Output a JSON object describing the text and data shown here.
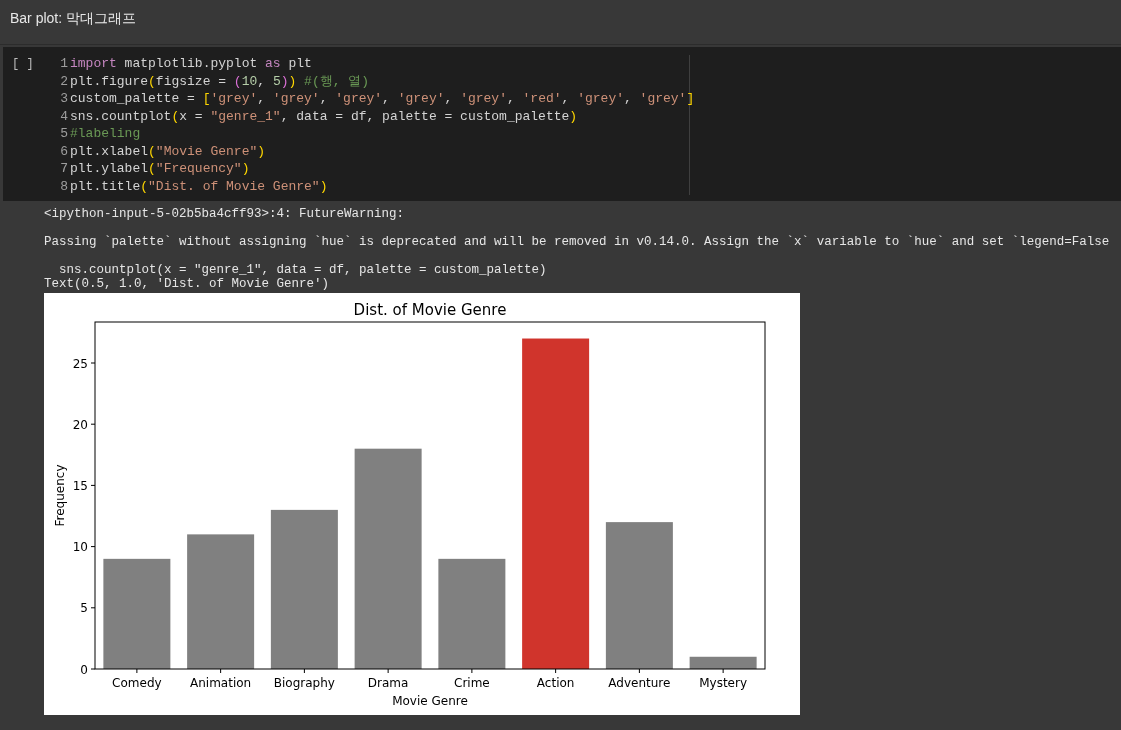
{
  "section_title": "Bar plot: 막대그래프",
  "code_cell": {
    "run_indicator": "[ ]",
    "lines": [
      {
        "n": "1",
        "tokens": [
          {
            "kind": "keyword",
            "text": "import"
          },
          {
            "kind": "plain",
            "text": " matplotlib.pyplot "
          },
          {
            "kind": "keyword",
            "text": "as"
          },
          {
            "kind": "plain",
            "text": " plt"
          }
        ]
      },
      {
        "n": "2",
        "tokens": [
          {
            "kind": "plain",
            "text": "plt.figure"
          },
          {
            "kind": "bracket",
            "text": "("
          },
          {
            "kind": "plain",
            "text": "figsize = "
          },
          {
            "kind": "bracket2",
            "text": "("
          },
          {
            "kind": "number",
            "text": "10"
          },
          {
            "kind": "plain",
            "text": ", "
          },
          {
            "kind": "number",
            "text": "5"
          },
          {
            "kind": "bracket2",
            "text": ")"
          },
          {
            "kind": "bracket",
            "text": ")"
          },
          {
            "kind": "comment",
            "text": " #(행, 열)"
          }
        ]
      },
      {
        "n": "3",
        "tokens": [
          {
            "kind": "plain",
            "text": "custom_palette = "
          },
          {
            "kind": "bracket",
            "text": "["
          },
          {
            "kind": "string",
            "text": "'grey'"
          },
          {
            "kind": "plain",
            "text": ", "
          },
          {
            "kind": "string",
            "text": "'grey'"
          },
          {
            "kind": "plain",
            "text": ", "
          },
          {
            "kind": "string",
            "text": "'grey'"
          },
          {
            "kind": "plain",
            "text": ", "
          },
          {
            "kind": "string",
            "text": "'grey'"
          },
          {
            "kind": "plain",
            "text": ", "
          },
          {
            "kind": "string",
            "text": "'grey'"
          },
          {
            "kind": "plain",
            "text": ", "
          },
          {
            "kind": "string",
            "text": "'red'"
          },
          {
            "kind": "plain",
            "text": ", "
          },
          {
            "kind": "string",
            "text": "'grey'"
          },
          {
            "kind": "plain",
            "text": ", "
          },
          {
            "kind": "string",
            "text": "'grey'"
          },
          {
            "kind": "bracket",
            "text": "]"
          }
        ]
      },
      {
        "n": "4",
        "tokens": [
          {
            "kind": "plain",
            "text": "sns.countplot"
          },
          {
            "kind": "bracket",
            "text": "("
          },
          {
            "kind": "plain",
            "text": "x = "
          },
          {
            "kind": "string",
            "text": "\"genre_1\""
          },
          {
            "kind": "plain",
            "text": ", data = df, palette = custom_palette"
          },
          {
            "kind": "bracket",
            "text": ")"
          }
        ]
      },
      {
        "n": "5",
        "tokens": [
          {
            "kind": "comment",
            "text": "#labeling"
          }
        ]
      },
      {
        "n": "6",
        "tokens": [
          {
            "kind": "plain",
            "text": "plt.xlabel"
          },
          {
            "kind": "bracket",
            "text": "("
          },
          {
            "kind": "string",
            "text": "\"Movie Genre\""
          },
          {
            "kind": "bracket",
            "text": ")"
          }
        ]
      },
      {
        "n": "7",
        "tokens": [
          {
            "kind": "plain",
            "text": "plt.ylabel"
          },
          {
            "kind": "bracket",
            "text": "("
          },
          {
            "kind": "string",
            "text": "\"Frequency\""
          },
          {
            "kind": "bracket",
            "text": ")"
          }
        ]
      },
      {
        "n": "8",
        "tokens": [
          {
            "kind": "plain",
            "text": "plt.title"
          },
          {
            "kind": "bracket",
            "text": "("
          },
          {
            "kind": "string",
            "text": "\"Dist. of Movie Genre\""
          },
          {
            "kind": "bracket",
            "text": ")"
          }
        ]
      }
    ]
  },
  "output": [
    {
      "kind": "warning_head",
      "text": "<ipython-input-5-02b5ba4cff93>:4: FutureWarning:"
    },
    {
      "kind": "warning_body",
      "text": "Passing `palette` without assigning `hue` is deprecated and will be removed in v0.14.0. Assign the `x` variable to `hue` and set `legend=False"
    },
    {
      "kind": "warning_source",
      "text": "  sns.countplot(x = \"genre_1\", data = df, palette = custom_palette)"
    },
    {
      "kind": "result",
      "text": "Text(0.5, 1.0, 'Dist. of Movie Genre')"
    }
  ],
  "chart_data": {
    "type": "bar",
    "title": "Dist. of Movie Genre",
    "xlabel": "Movie Genre",
    "ylabel": "Frequency",
    "categories": [
      "Comedy",
      "Animation",
      "Biography",
      "Drama",
      "Crime",
      "Action",
      "Adventure",
      "Mystery"
    ],
    "series": [
      {
        "colors": [
          "#808080",
          "#808080",
          "#808080",
          "#808080",
          "#808080",
          "#d0342c",
          "#808080",
          "#808080"
        ],
        "values": [
          9,
          11,
          13,
          18,
          9,
          27,
          12,
          1
        ]
      }
    ],
    "ylim": [
      0,
      28.35
    ],
    "yticks": [
      0,
      5,
      10,
      15,
      20,
      25
    ]
  }
}
